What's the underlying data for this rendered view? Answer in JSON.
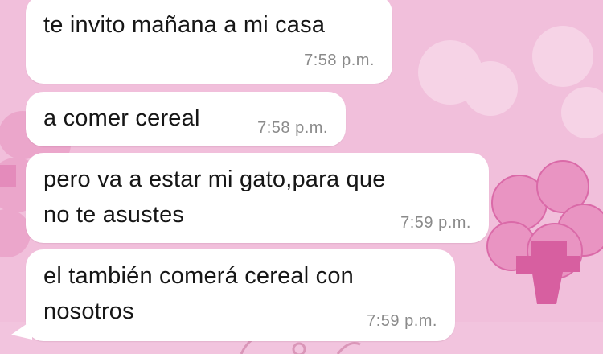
{
  "chat": {
    "background_color": "#f1bfdb",
    "bubble_color": "#ffffff",
    "messages": [
      {
        "lines": [
          "te invito mañana a mi casa"
        ],
        "time": "7:58 p.m."
      },
      {
        "lines": [
          "a comer cereal"
        ],
        "time": "7:58 p.m."
      },
      {
        "lines": [
          "pero va a estar mi gato,para que",
          "no te asustes"
        ],
        "time": "7:59 p.m."
      },
      {
        "lines": [
          "el también comerá cereal con",
          "nosotros"
        ],
        "time": "7:59 p.m."
      }
    ]
  }
}
